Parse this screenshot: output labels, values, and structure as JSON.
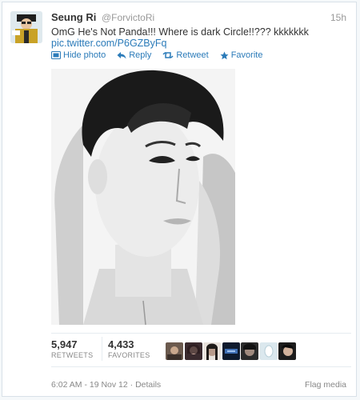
{
  "tweet": {
    "fullname": "Seung Ri",
    "username": "@ForvictoRi",
    "time": "15h",
    "text": "OmG He's Not Panda!!! Where is dark Circle!!??? kkkkkkk",
    "link": "pic.twitter.com/P6GZByFq"
  },
  "actions": {
    "hide_photo": "Hide photo",
    "reply": "Reply",
    "retweet": "Retweet",
    "favorite": "Favorite"
  },
  "stats": {
    "retweets_count": "5,947",
    "retweets_label": "RETWEETS",
    "favorites_count": "4,433",
    "favorites_label": "FAVORITES"
  },
  "footer": {
    "timestamp": "6:02 AM - 19 Nov 12",
    "separator": " · ",
    "details": "Details",
    "flag_media": "Flag media"
  },
  "colors": {
    "link": "#2b7bb9",
    "muted": "#999999"
  }
}
